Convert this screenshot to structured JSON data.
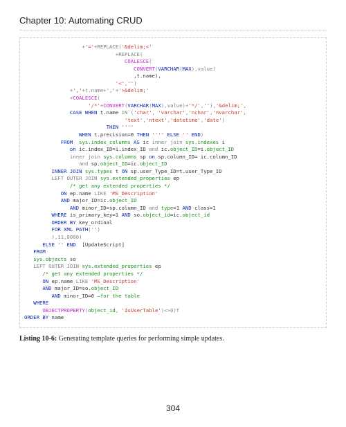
{
  "header": {
    "title": "Chapter 10: Automating CRUD"
  },
  "code": {
    "l01a": "+",
    "l01b": "'='",
    "l01c": "+REPLACE(",
    "l01d": "'&delim;<'",
    "l02a": "+REPLACE(",
    "l03a": "COALESCE",
    "l03b": "(",
    "l04a": "CONVERT",
    "l04b": "(",
    "l04c": "VARCHAR",
    "l04d": "(",
    "l04e": "MAX",
    "l04f": "),value)",
    "l05a": ",t.name),",
    "l06a": "'<'",
    "l06b": ",",
    "l06c": "''",
    "l06d": ")",
    "l07a": "+",
    "l07b": "','",
    "l07c": "+t.name+",
    "l07d": "','",
    "l07e": "+",
    "l07f": "'>&delim;'",
    "l08a": "+",
    "l08b": "COALESCE",
    "l08c": "(",
    "l09a": "'/*'",
    "l09b": "+",
    "l09c": "CONVERT",
    "l09d": "(",
    "l09e": "VARCHAR",
    "l09f": "(",
    "l09g": "MAX",
    "l09h": "),value)+",
    "l09i": "'*/'",
    "l09j": ",",
    "l09k": "''",
    "l09l": "),",
    "l09m": "'&delim;'",
    "l09n": ",",
    "l10a": "CASE WHEN",
    "l10b": " t.name ",
    "l10c": "IN",
    "l10d": " (",
    "l10e": "'char'",
    "l10f": ", ",
    "l10g": "'varchar'",
    "l10h": ",",
    "l10i": "'nchar'",
    "l10j": ",",
    "l10k": "'nvarchar'",
    "l10l": ",",
    "l11a": "'text'",
    "l11b": ",",
    "l11c": "'ntext'",
    "l11d": ",",
    "l11e": "'datetime'",
    "l11f": ",",
    "l11g": "'date'",
    "l11h": ")",
    "l12a": "THEN ",
    "l12b": "''''",
    "l13a": "WHEN",
    "l13b": " t.precision=0 ",
    "l13c": "THEN ",
    "l13d": "''''",
    "l13e": " ELSE ",
    "l13f": "''",
    "l13g": " END",
    "l13h": ")",
    "l14a": "FROM  ",
    "l14b": "sys.index_columns",
    "l14c": " AS",
    "l14d": " ic ",
    "l14e": "inner join ",
    "l14f": "sys.indexes",
    "l14g": " i",
    "l15a": "on",
    "l15b": " ic.index_ID=i.index_ID ",
    "l15c": "and",
    "l15d": " ic.",
    "l15e": "object_ID",
    "l15f": "=i.",
    "l15g": "object_ID",
    "l16a": "inner join ",
    "l16b": "sys.columns",
    "l16c": " sp ",
    "l16d": "on",
    "l16e": " sp.column_ID= ic.column_ID",
    "l17a": "and",
    "l17b": " sp.",
    "l17c": "object_ID",
    "l17d": "=ic.",
    "l17e": "object_ID",
    "l18a": "INNER JOIN ",
    "l18b": "sys.types",
    "l18c": " t ",
    "l18d": "ON",
    "l18e": " sp.user_Type_ID=t.user_Type_ID",
    "l19a": "LEFT OUTER JOIN ",
    "l19b": "sys.extended_properties",
    "l19c": " ep",
    "l20a": "/* get any extended properties */",
    "l21a": "ON",
    "l21b": " ep.name ",
    "l21c": "LIKE ",
    "l21d": "'MS_Description'",
    "l22a": "AND",
    "l22b": " major_ID=ic.",
    "l22c": "object_ID",
    "l23a": "AND",
    "l23b": " minor_ID=sp.column_ID ",
    "l23c": "and ",
    "l23d": "type",
    "l23e": "=1 ",
    "l23f": "AND",
    "l23g": " class=1",
    "l24a": "WHERE",
    "l24b": " is_primary_key=1 ",
    "l24c": "AND",
    "l24d": " so.",
    "l24e": "object_id",
    "l24f": "=ic.",
    "l24g": "object_id",
    "l25a": "ORDER BY",
    "l25b": " key_ordinal",
    "l26a": "FOR XML PATH",
    "l26b": "(",
    "l26c": "''",
    "l26d": ")",
    "l27a": "),11,8000)",
    "l28a": "ELSE ",
    "l28b": "''",
    "l28c": " END",
    "l28d": "  [UpdateScript]",
    "l29a": "FROM",
    "l30a": "sys.objects",
    "l30b": " so",
    "l31a": "LEFT OUTER JOIN ",
    "l31b": "sys.extended_properties",
    "l31c": " ep",
    "l32a": "/* get any extended properties */",
    "l33a": "ON",
    "l33b": " ep.name ",
    "l33c": "LIKE ",
    "l33d": "'MS_Description'",
    "l34a": "AND",
    "l34b": " major_ID=so.",
    "l34c": "object_ID",
    "l35a": "AND",
    "l35b": " minor_ID=0 ",
    "l35c": "—for the table",
    "l36a": "WHERE",
    "l37a": "OBJECTPROPERTY",
    "l37b": "(",
    "l37c": "object_id",
    "l37d": ", ",
    "l37e": "'IsUserTable'",
    "l37f": ")<>0)f",
    "l38a": "ORDER BY",
    "l38b": " name"
  },
  "listing": {
    "label": "Listing 10-6:",
    "caption": " Generating template queries for performing simple updates."
  },
  "footer": {
    "page": "304"
  }
}
